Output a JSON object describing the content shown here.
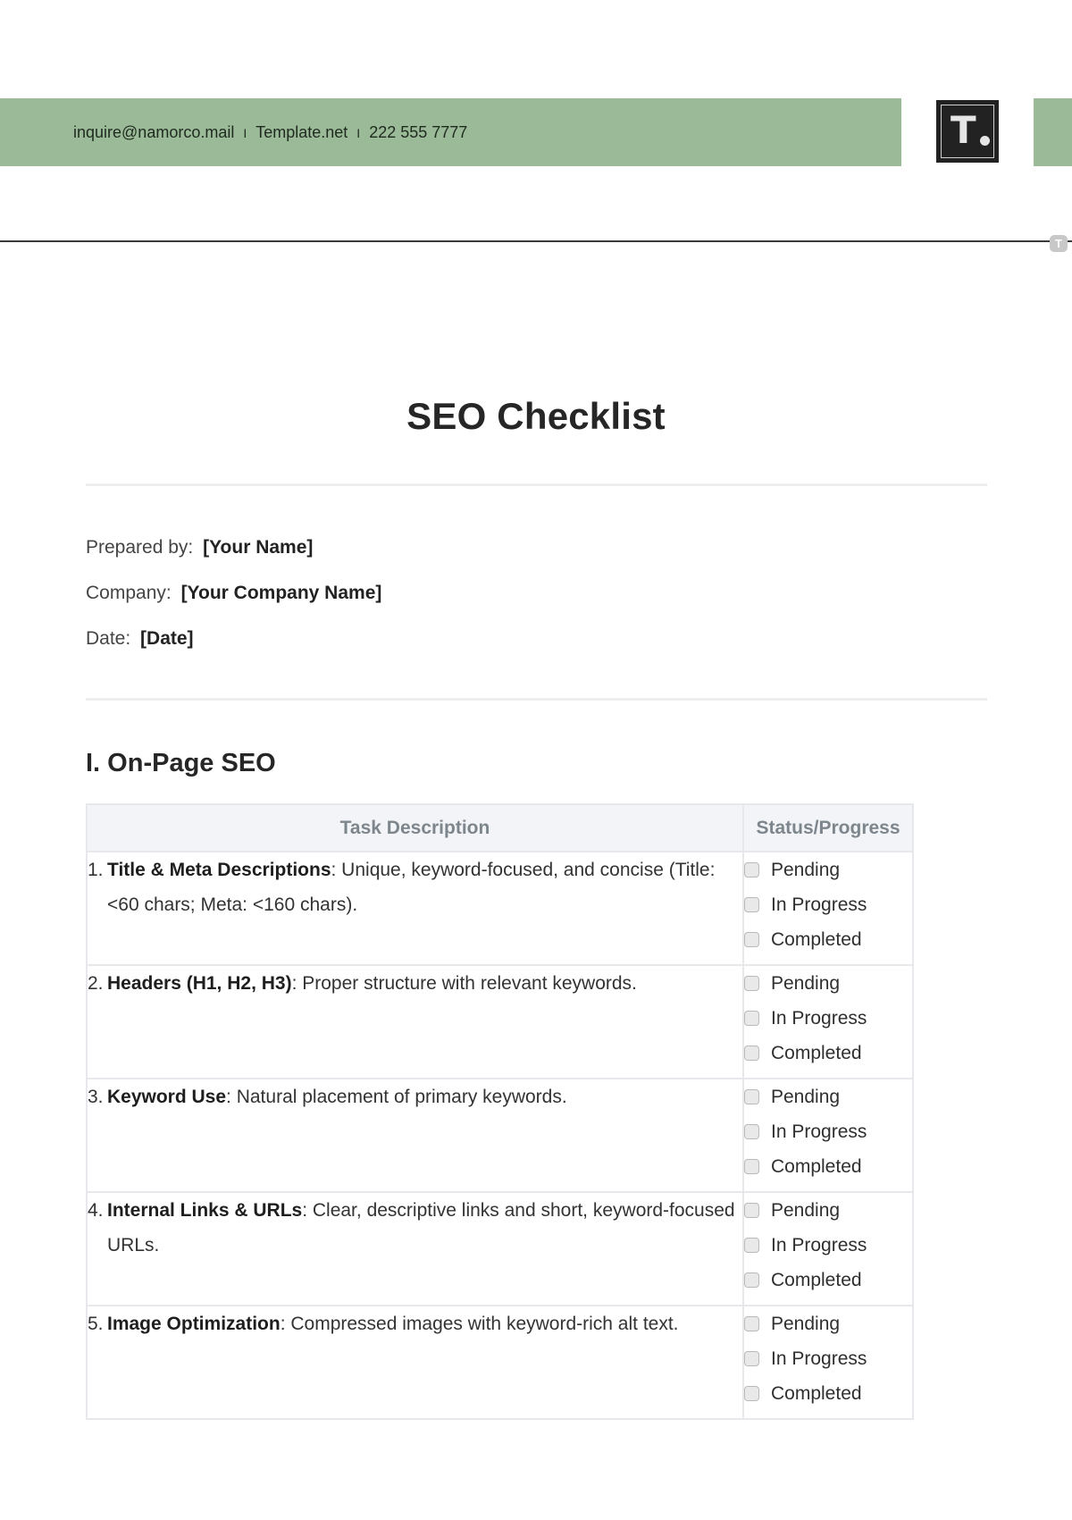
{
  "header": {
    "contact": {
      "email": "inquire@namorco.mail",
      "website": "Template.net",
      "phone": "222 555 7777",
      "separator": "I"
    },
    "logo": {
      "letter": "T",
      "icon": "template-logo-icon"
    },
    "colors": {
      "band": "#9bba98",
      "logo_bg": "#222222"
    }
  },
  "document": {
    "title": "SEO Checklist",
    "meta": [
      {
        "label": "Prepared by:",
        "value": "[Your Name]"
      },
      {
        "label": "Company:",
        "value": "[Your Company Name]"
      },
      {
        "label": "Date:",
        "value": "[Date]"
      }
    ]
  },
  "section": {
    "heading": "I. On-Page SEO",
    "table": {
      "columns": [
        "Task Description",
        "Status/Progress"
      ],
      "status_options": [
        "Pending",
        "In Progress",
        "Completed"
      ],
      "rows": [
        {
          "num": "1.",
          "title": "Title & Meta Descriptions",
          "desc": ": Unique, keyword-focused, and concise (Title: <60 chars; Meta: <160 chars).",
          "checked": [
            false,
            false,
            false
          ]
        },
        {
          "num": "2.",
          "title": "Headers (H1, H2, H3)",
          "desc": ": Proper structure with relevant keywords.",
          "checked": [
            false,
            false,
            false
          ]
        },
        {
          "num": "3.",
          "title": "Keyword Use",
          "desc": ": Natural placement of primary keywords.",
          "checked": [
            false,
            false,
            false
          ]
        },
        {
          "num": "4.",
          "title": "Internal Links & URLs",
          "desc": ": Clear, descriptive links and short, keyword-focused URLs.",
          "checked": [
            false,
            false,
            false
          ]
        },
        {
          "num": "5.",
          "title": "Image Optimization",
          "desc": ": Compressed images with keyword-rich alt text.",
          "checked": [
            false,
            false,
            false
          ]
        }
      ]
    }
  }
}
